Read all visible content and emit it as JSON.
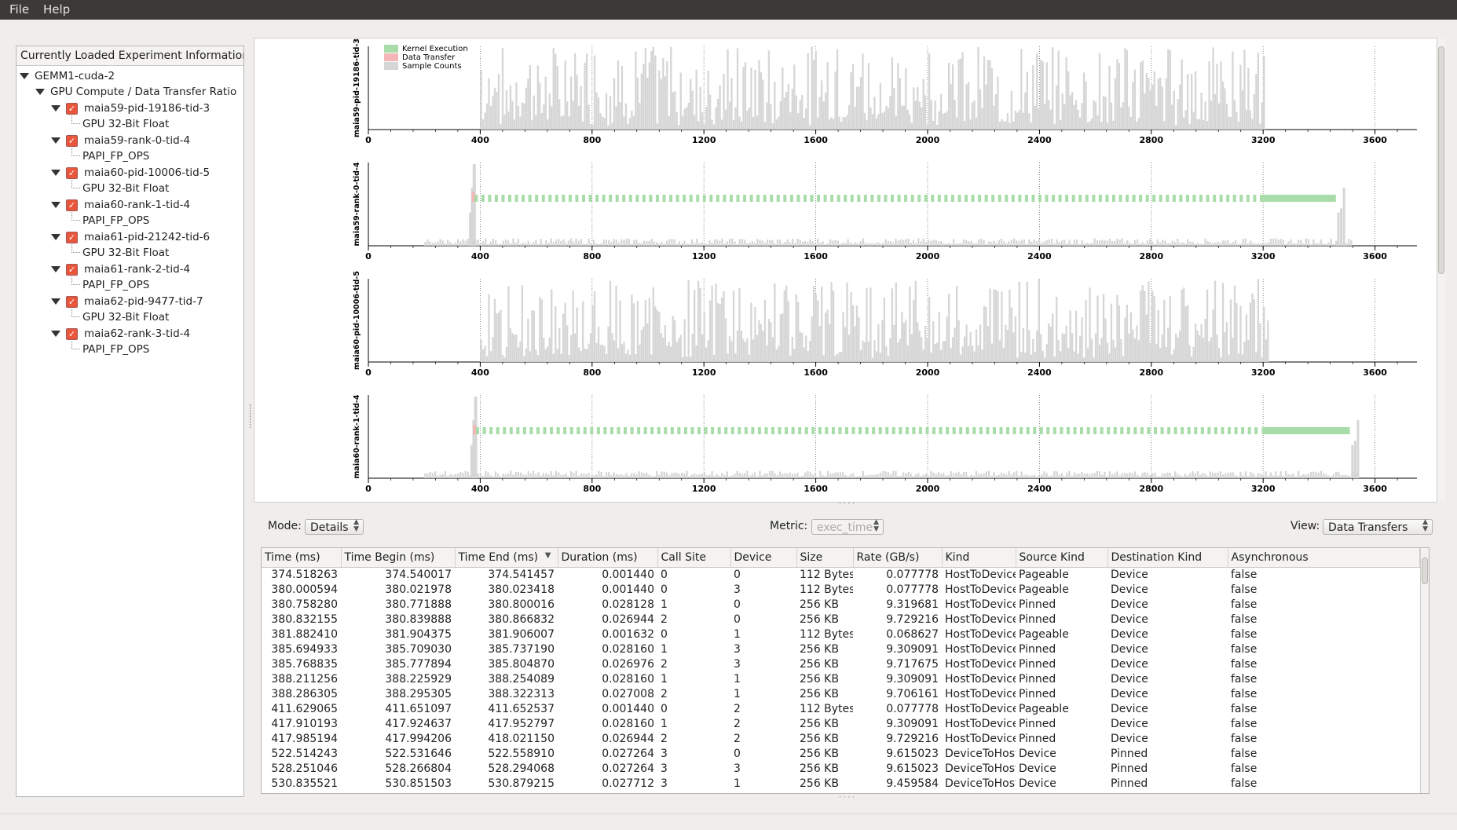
{
  "menu": {
    "file": "File",
    "help": "Help"
  },
  "tree": {
    "header": "Currently Loaded Experiment Information",
    "root": "GEMM1-cuda-2",
    "group": "GPU Compute / Data Transfer Ratio",
    "nodes": [
      {
        "name": "maia59-pid-19186-tid-3",
        "metric": "GPU 32-Bit Float"
      },
      {
        "name": "maia59-rank-0-tid-4",
        "metric": "PAPI_FP_OPS"
      },
      {
        "name": "maia60-pid-10006-tid-5",
        "metric": "GPU 32-Bit Float"
      },
      {
        "name": "maia60-rank-1-tid-4",
        "metric": "PAPI_FP_OPS"
      },
      {
        "name": "maia61-pid-21242-tid-6",
        "metric": "GPU 32-Bit Float"
      },
      {
        "name": "maia61-rank-2-tid-4",
        "metric": "PAPI_FP_OPS"
      },
      {
        "name": "maia62-pid-9477-tid-7",
        "metric": "GPU 32-Bit Float"
      },
      {
        "name": "maia62-rank-3-tid-4",
        "metric": "PAPI_FP_OPS"
      }
    ]
  },
  "legend": {
    "items": [
      {
        "label": "Kernel Execution",
        "color": "#a8dca8"
      },
      {
        "label": "Data Transfer",
        "color": "#f4b6b6"
      },
      {
        "label": "Sample Counts",
        "color": "#d6d6d6"
      }
    ]
  },
  "chart_data": [
    {
      "type": "bar",
      "ylabel": "maia59-pid-19186-tid-3",
      "xticks": [
        0,
        400,
        800,
        1200,
        1600,
        2000,
        2400,
        2800,
        3200,
        3600
      ],
      "xlim": [
        0,
        3750
      ],
      "sample_range": [
        400,
        3200
      ],
      "kernel_bars": false,
      "legend_placement": "top-left"
    },
    {
      "type": "bar",
      "ylabel": "maia59-rank-0-tid-4",
      "xticks": [
        0,
        400,
        800,
        1200,
        1600,
        2000,
        2400,
        2800,
        3200,
        3600
      ],
      "xlim": [
        0,
        3750
      ],
      "sample_range": [
        200,
        3520
      ],
      "kernel_bars": true,
      "kernel_span": [
        375,
        3460
      ]
    },
    {
      "type": "bar",
      "ylabel": "maia60-pid-10006-tid-5",
      "xticks": [
        0,
        400,
        800,
        1200,
        1600,
        2000,
        2400,
        2800,
        3200,
        3600
      ],
      "xlim": [
        0,
        3750
      ],
      "sample_range": [
        400,
        3220
      ],
      "kernel_bars": false
    },
    {
      "type": "bar",
      "ylabel": "maia60-rank-1-tid-4",
      "xticks": [
        0,
        400,
        800,
        1200,
        1600,
        2000,
        2400,
        2800,
        3200,
        3600
      ],
      "xlim": [
        0,
        3750
      ],
      "sample_range": [
        200,
        3530
      ],
      "kernel_bars": true,
      "kernel_span": [
        380,
        3510
      ]
    }
  ],
  "controls": {
    "mode_label": "Mode:",
    "mode_value": "Details",
    "metric_label": "Metric:",
    "metric_value": "exec_time",
    "view_label": "View:",
    "view_value": "Data Transfers"
  },
  "table": {
    "columns": [
      "Time (ms)",
      "Time Begin (ms)",
      "Time End (ms)",
      "Duration (ms)",
      "Call Site",
      "Device",
      "Size",
      "Rate (GB/s)",
      "Kind",
      "Source Kind",
      "Destination Kind",
      "Asynchronous"
    ],
    "sort_indicator": "▼",
    "rows": [
      [
        "374.518263",
        "374.540017",
        "374.541457",
        "0.001440",
        "0",
        "0",
        "112 Bytes",
        "0.077778",
        "HostToDevice",
        "Pageable",
        "Device",
        "false"
      ],
      [
        "380.000594",
        "380.021978",
        "380.023418",
        "0.001440",
        "0",
        "3",
        "112 Bytes",
        "0.077778",
        "HostToDevice",
        "Pageable",
        "Device",
        "false"
      ],
      [
        "380.758280",
        "380.771888",
        "380.800016",
        "0.028128",
        "1",
        "0",
        "256 KB",
        "9.319681",
        "HostToDevice",
        "Pinned",
        "Device",
        "false"
      ],
      [
        "380.832155",
        "380.839888",
        "380.866832",
        "0.026944",
        "2",
        "0",
        "256 KB",
        "9.729216",
        "HostToDevice",
        "Pinned",
        "Device",
        "false"
      ],
      [
        "381.882410",
        "381.904375",
        "381.906007",
        "0.001632",
        "0",
        "1",
        "112 Bytes",
        "0.068627",
        "HostToDevice",
        "Pageable",
        "Device",
        "false"
      ],
      [
        "385.694933",
        "385.709030",
        "385.737190",
        "0.028160",
        "1",
        "3",
        "256 KB",
        "9.309091",
        "HostToDevice",
        "Pinned",
        "Device",
        "false"
      ],
      [
        "385.768835",
        "385.777894",
        "385.804870",
        "0.026976",
        "2",
        "3",
        "256 KB",
        "9.717675",
        "HostToDevice",
        "Pinned",
        "Device",
        "false"
      ],
      [
        "388.211256",
        "388.225929",
        "388.254089",
        "0.028160",
        "1",
        "1",
        "256 KB",
        "9.309091",
        "HostToDevice",
        "Pinned",
        "Device",
        "false"
      ],
      [
        "388.286305",
        "388.295305",
        "388.322313",
        "0.027008",
        "2",
        "1",
        "256 KB",
        "9.706161",
        "HostToDevice",
        "Pinned",
        "Device",
        "false"
      ],
      [
        "411.629065",
        "411.651097",
        "411.652537",
        "0.001440",
        "0",
        "2",
        "112 Bytes",
        "0.077778",
        "HostToDevice",
        "Pageable",
        "Device",
        "false"
      ],
      [
        "417.910193",
        "417.924637",
        "417.952797",
        "0.028160",
        "1",
        "2",
        "256 KB",
        "9.309091",
        "HostToDevice",
        "Pinned",
        "Device",
        "false"
      ],
      [
        "417.985194",
        "417.994206",
        "418.021150",
        "0.026944",
        "2",
        "2",
        "256 KB",
        "9.729216",
        "HostToDevice",
        "Pinned",
        "Device",
        "false"
      ],
      [
        "522.514243",
        "522.531646",
        "522.558910",
        "0.027264",
        "3",
        "0",
        "256 KB",
        "9.615023",
        "DeviceToHost",
        "Device",
        "Pinned",
        "false"
      ],
      [
        "528.251046",
        "528.266804",
        "528.294068",
        "0.027264",
        "3",
        "3",
        "256 KB",
        "9.615023",
        "DeviceToHost",
        "Device",
        "Pinned",
        "false"
      ],
      [
        "530.835521",
        "530.851503",
        "530.879215",
        "0.027712",
        "3",
        "1",
        "256 KB",
        "9.459584",
        "DeviceToHost",
        "Device",
        "Pinned",
        "false"
      ]
    ]
  }
}
